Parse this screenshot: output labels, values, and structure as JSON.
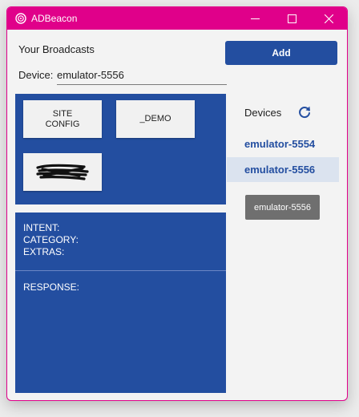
{
  "window": {
    "title": "ADBeacon",
    "accent_color": "#e0008a",
    "brand_blue": "#234ea0",
    "controls": [
      "minimize-icon",
      "maximize-icon",
      "close-icon"
    ]
  },
  "header": {
    "broadcasts_label": "Your Broadcasts",
    "device_label": "Device:",
    "device_value": "emulator-5556",
    "add_label": "Add"
  },
  "broadcast_tiles": [
    {
      "label_line1": "SITE",
      "label_line2": "CONFIG"
    },
    {
      "label_line1": "_DEMO",
      "label_line2": ""
    }
  ],
  "info": {
    "intent_label": "INTENT:",
    "category_label": "CATEGORY:",
    "extras_label": "EXTRAS:",
    "response_label": "RESPONSE:"
  },
  "devices": {
    "title": "Devices",
    "refresh_icon": "refresh-icon",
    "items": [
      {
        "label": "emulator-5554",
        "selected": false
      },
      {
        "label": "emulator-5556",
        "selected": true
      }
    ],
    "tooltip": "emulator-5556"
  }
}
